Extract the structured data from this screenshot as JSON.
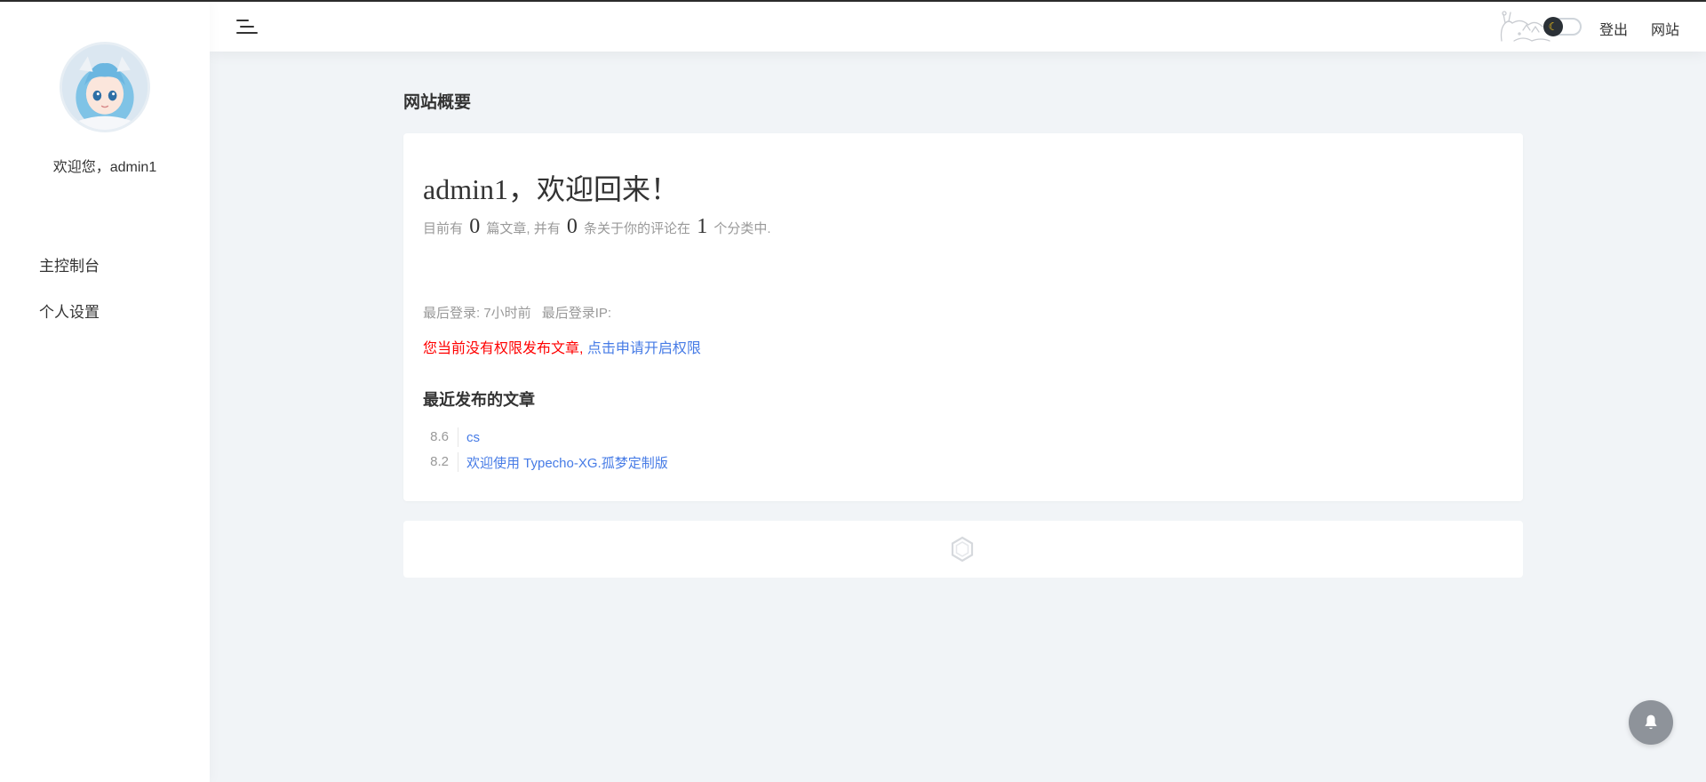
{
  "sidebar": {
    "welcome_user": "欢迎您，admin1",
    "items": [
      {
        "label": "主控制台"
      },
      {
        "label": "个人设置"
      }
    ]
  },
  "header": {
    "logout_label": "登出",
    "site_label": "网站",
    "theme_icon": "moon-icon"
  },
  "main": {
    "page_title": "网站概要",
    "greeting": "admin1，欢迎回来！",
    "stats": {
      "prefix": "目前有",
      "posts_count": "0",
      "posts_text": "篇文章, 并有",
      "comments_count": "0",
      "comments_text": "条关于你的评论在",
      "categories_count": "1",
      "categories_text": "个分类中."
    },
    "last_login_label": "最后登录: 7小时前",
    "last_login_ip_label": "最后登录IP:",
    "permission_warning": "您当前没有权限发布文章,",
    "permission_apply_link": "点击申请开启权限",
    "recent_title": "最近发布的文章",
    "recent_posts": [
      {
        "date": "8.6",
        "title": "cs"
      },
      {
        "date": "8.2",
        "title": "欢迎使用 Typecho-XG.孤梦定制版"
      }
    ]
  },
  "colors": {
    "accent": "#467be6",
    "warning": "#ff0000",
    "background": "#f1f4f7"
  }
}
